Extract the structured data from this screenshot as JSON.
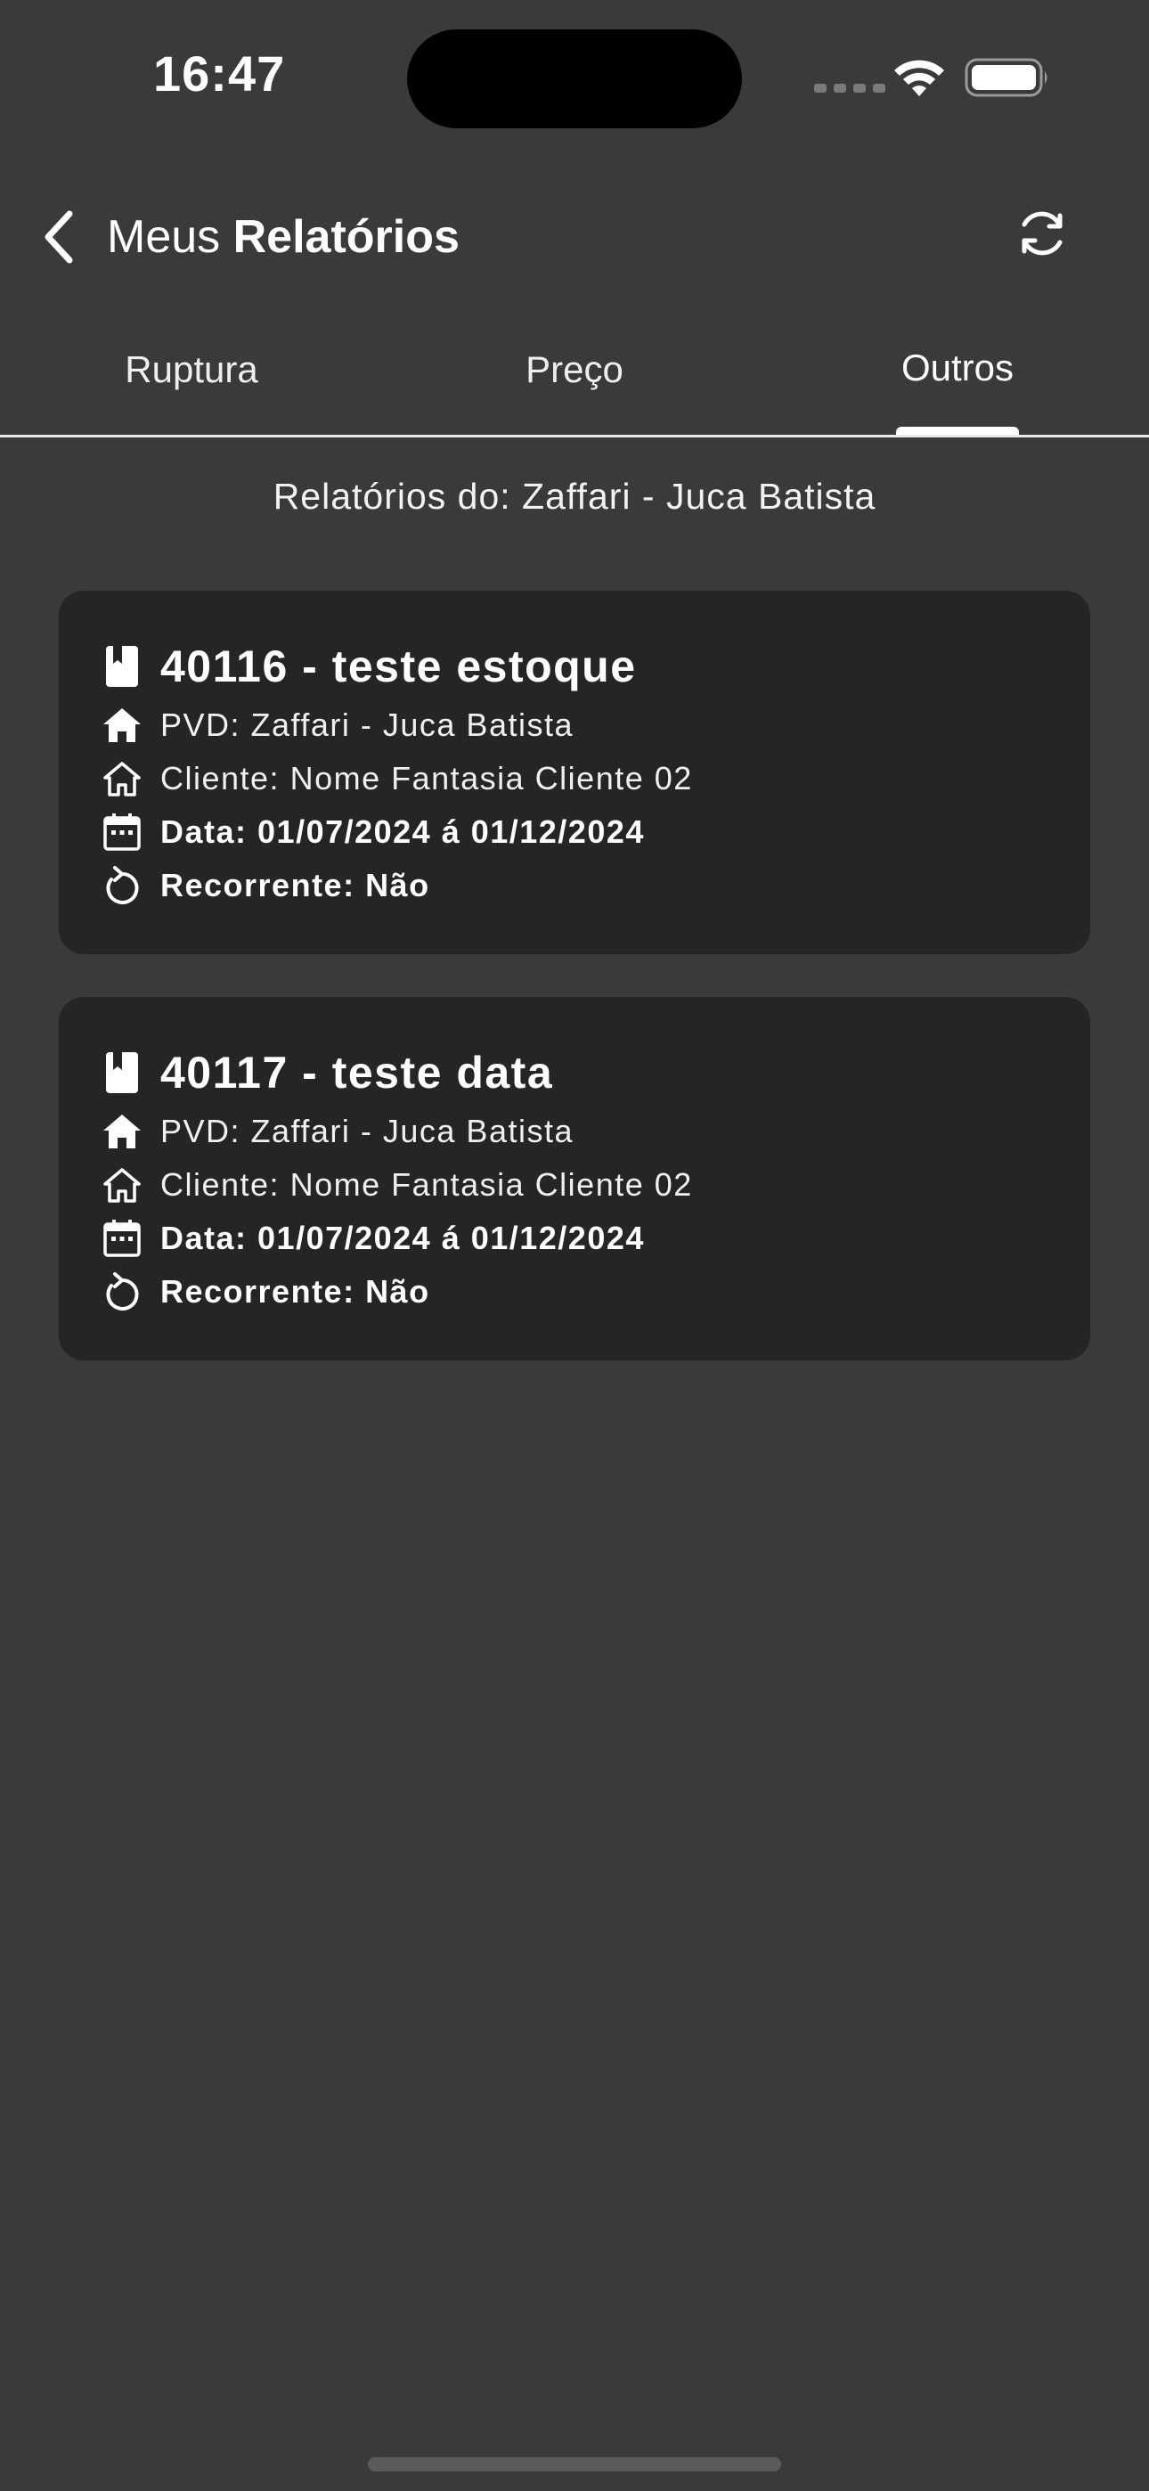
{
  "status_bar": {
    "time": "16:47"
  },
  "header": {
    "title_prefix": "Meus",
    "title_bold": "Relatórios",
    "back_icon": "chevron-left-icon",
    "refresh_icon": "refresh-icon"
  },
  "tabs": [
    {
      "label": "Ruptura",
      "active": false
    },
    {
      "label": "Preço",
      "active": false
    },
    {
      "label": "Outros",
      "active": true
    }
  ],
  "subtitle": "Relatórios do: Zaffari - Juca Batista",
  "reports": [
    {
      "title": "40116 - teste estoque",
      "pvd": "PVD: Zaffari - Juca Batista",
      "cliente": "Cliente: Nome Fantasia Cliente 02",
      "data": "Data: 01/07/2024 á 01/12/2024",
      "recorrente": "Recorrente: Não"
    },
    {
      "title": "40117 - teste data",
      "pvd": "PVD: Zaffari - Juca Batista",
      "cliente": "Cliente: Nome Fantasia Cliente 02",
      "data": "Data: 01/07/2024 á 01/12/2024",
      "recorrente": "Recorrente: Não"
    }
  ],
  "colors": {
    "background": "#3b3a39",
    "card": "#262525",
    "text": "#ffffff"
  }
}
